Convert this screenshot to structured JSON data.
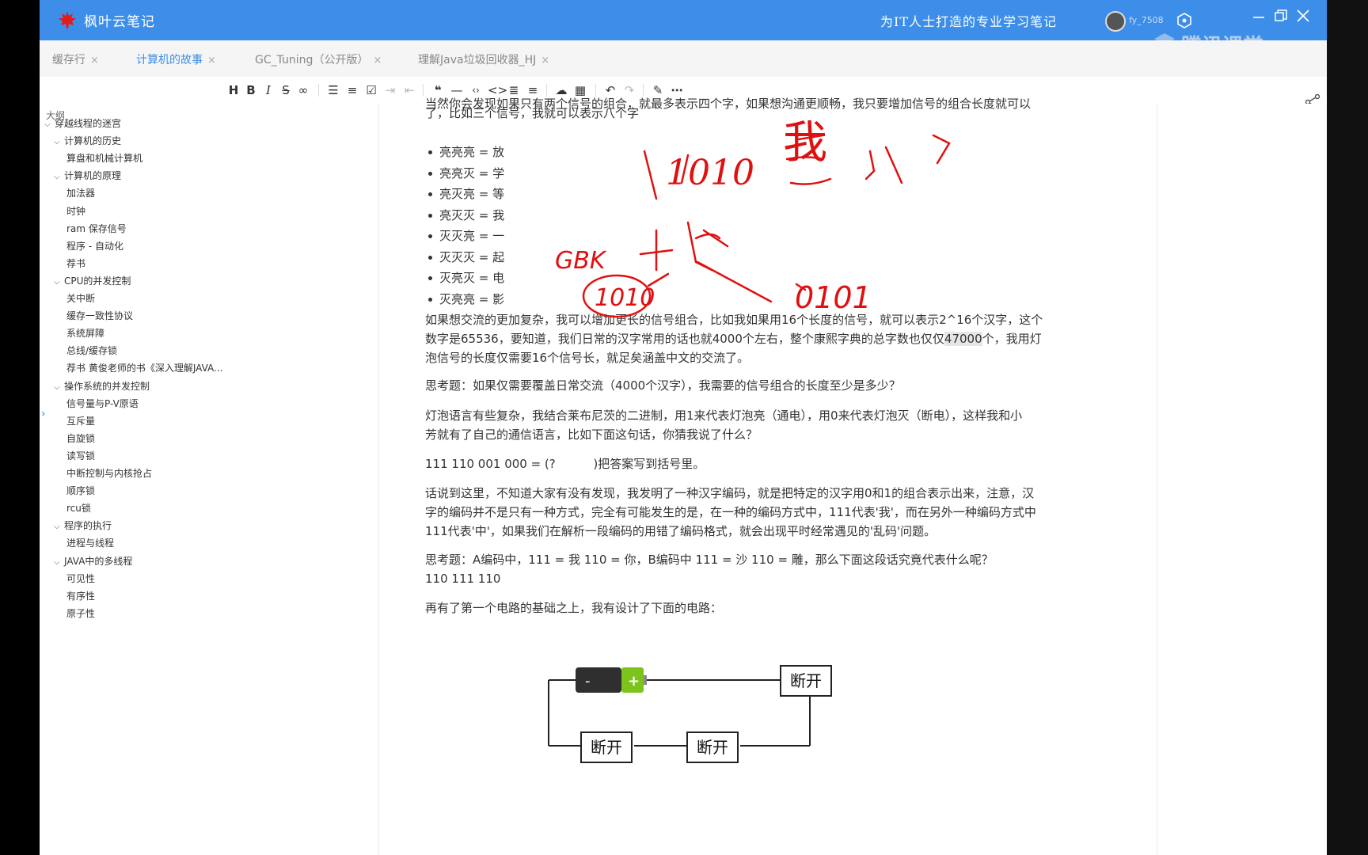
{
  "app": {
    "name": "枫叶云笔记",
    "slogan": "为IT人士打造的专业学习笔记",
    "username": "fy_7508",
    "watermark": "腾讯课堂",
    "window_controls": [
      "minimize-icon",
      "restore-icon",
      "close-icon"
    ]
  },
  "tabs": [
    {
      "label": "缓存行",
      "active": false
    },
    {
      "label": "计算机的故事",
      "active": true
    },
    {
      "label": "GC_Tuning（公开版）",
      "active": false
    },
    {
      "label": "理解Java垃圾回收器_HJ",
      "active": false
    }
  ],
  "toolbar": {
    "items": [
      "H",
      "B",
      "I",
      "S",
      "link",
      "bullet-list",
      "ordered-list",
      "task-list",
      "indent",
      "outdent",
      "quote",
      "hr",
      "code-inline",
      "code-block",
      "align",
      "align-more",
      "upload",
      "table",
      "undo",
      "redo",
      "pen",
      "more"
    ]
  },
  "share_label": "分享",
  "outline": {
    "title": "大纲",
    "items": [
      {
        "label": "穿越线程的迷宫",
        "level": 0,
        "chevron": true
      },
      {
        "label": "计算机的历史",
        "level": 1,
        "chevron": true
      },
      {
        "label": "算盘和机械计算机",
        "level": 2,
        "chevron": false
      },
      {
        "label": "计算机的原理",
        "level": 1,
        "chevron": true
      },
      {
        "label": "加法器",
        "level": 2,
        "chevron": false
      },
      {
        "label": "时钟",
        "level": 2,
        "chevron": false
      },
      {
        "label": "ram 保存信号",
        "level": 2,
        "chevron": false
      },
      {
        "label": "程序 - 自动化",
        "level": 2,
        "chevron": false
      },
      {
        "label": "荐书",
        "level": 2,
        "chevron": false
      },
      {
        "label": "CPU的并发控制",
        "level": 1,
        "chevron": true
      },
      {
        "label": "关中断",
        "level": 2,
        "chevron": false
      },
      {
        "label": "缓存一致性协议",
        "level": 2,
        "chevron": false
      },
      {
        "label": "系统屏障",
        "level": 2,
        "chevron": false
      },
      {
        "label": "总线/缓存锁",
        "level": 2,
        "chevron": false
      },
      {
        "label": "荐书 黄俊老师的书《深入理解JAVA...",
        "level": 2,
        "chevron": false
      },
      {
        "label": "操作系统的并发控制",
        "level": 1,
        "chevron": true
      },
      {
        "label": "信号量与P-V原语",
        "level": 2,
        "chevron": false
      },
      {
        "label": "互斥量",
        "level": 2,
        "chevron": false
      },
      {
        "label": "自旋锁",
        "level": 2,
        "chevron": false
      },
      {
        "label": "读写锁",
        "level": 2,
        "chevron": false
      },
      {
        "label": "中断控制与内核抢占",
        "level": 2,
        "chevron": false
      },
      {
        "label": "顺序锁",
        "level": 2,
        "chevron": false
      },
      {
        "label": "rcu锁",
        "level": 2,
        "chevron": false
      },
      {
        "label": "程序的执行",
        "level": 1,
        "chevron": true
      },
      {
        "label": "进程与线程",
        "level": 2,
        "chevron": false
      },
      {
        "label": "JAVA中的多线程",
        "level": 1,
        "chevron": true
      },
      {
        "label": "可见性",
        "level": 2,
        "chevron": false
      },
      {
        "label": "有序性",
        "level": 2,
        "chevron": false
      },
      {
        "label": "原子性",
        "level": 2,
        "chevron": false
      }
    ]
  },
  "doc": {
    "cut_line": "当然你会发现如果只有两个信号的组合，就最多表示四个字，如果想沟通更顺畅，我只要增加信号的组合长度就可以",
    "line_intro": "了，比如三个信号，我就可以表示八个字",
    "bullets": [
      "亮亮亮 = 放",
      "亮亮灭 = 学",
      "亮灭亮 = 等",
      "亮灭灭 = 我",
      "灭灭亮 = 一",
      "灭灭灭 = 起",
      "灭亮灭 = 电",
      "灭亮亮 = 影"
    ],
    "para1": [
      "如果想交流的更加复杂，我可以增加更长的信号组合，比如我如果用16个长度的信号，就可以表示2^16个汉字，这个",
      "数字是65536，要知道，我们日常的汉字常用的话也就4000个左右，整个康熙字典的总字数也仅仅",
      "47000",
      "个，我用灯",
      "泡信号的长度仅需要16个信号长，就足矣涵盖中文的交流了。"
    ],
    "q1": "思考题：如果仅需要覆盖日常交流（4000个汉字），我需要的信号组合的长度至少是多少？",
    "para2": [
      "灯泡语言有些复杂，我结合莱布尼茨的二进制，用1来代表灯泡亮（通电），用0来代表灯泡灭（断电），这样我和小",
      "芳就有了自己的通信语言，比如下面这句话，你猜我说了什么？"
    ],
    "code_q": "111 110 001 000 = (?          )把答案写到括号里。",
    "para3": [
      "话说到这里，不知道大家有没有发现，我发明了一种汉字编码，就是把特定的汉字用0和1的组合表示出来，注意，汉",
      "字的编码并不是只有一种方式，完全有可能发生的是，在一种的编码方式中，111代表'我'，而在另外一种编码方式中",
      "111代表'中'，如果我们在解析一段编码的用错了编码格式，就会出现平时经常遇见的'乱码'问题。"
    ],
    "q2": [
      "思考题：A编码中，111 = 我 110 = 你，B编码中 111 = 沙 110 = 雕，那么下面这段话究竟代表什么呢？",
      "110 111 110"
    ],
    "para4": "再有了第一个电路的基础之上，我有设计了下面的电路：",
    "circuit": {
      "battery_minus": "-",
      "battery_plus": "+",
      "switches": [
        "断开",
        "断开",
        "断开"
      ]
    }
  },
  "annotations": {
    "texts": [
      "1010",
      "我",
      "GBK",
      "1010",
      "0101"
    ],
    "color": "#e01010"
  }
}
